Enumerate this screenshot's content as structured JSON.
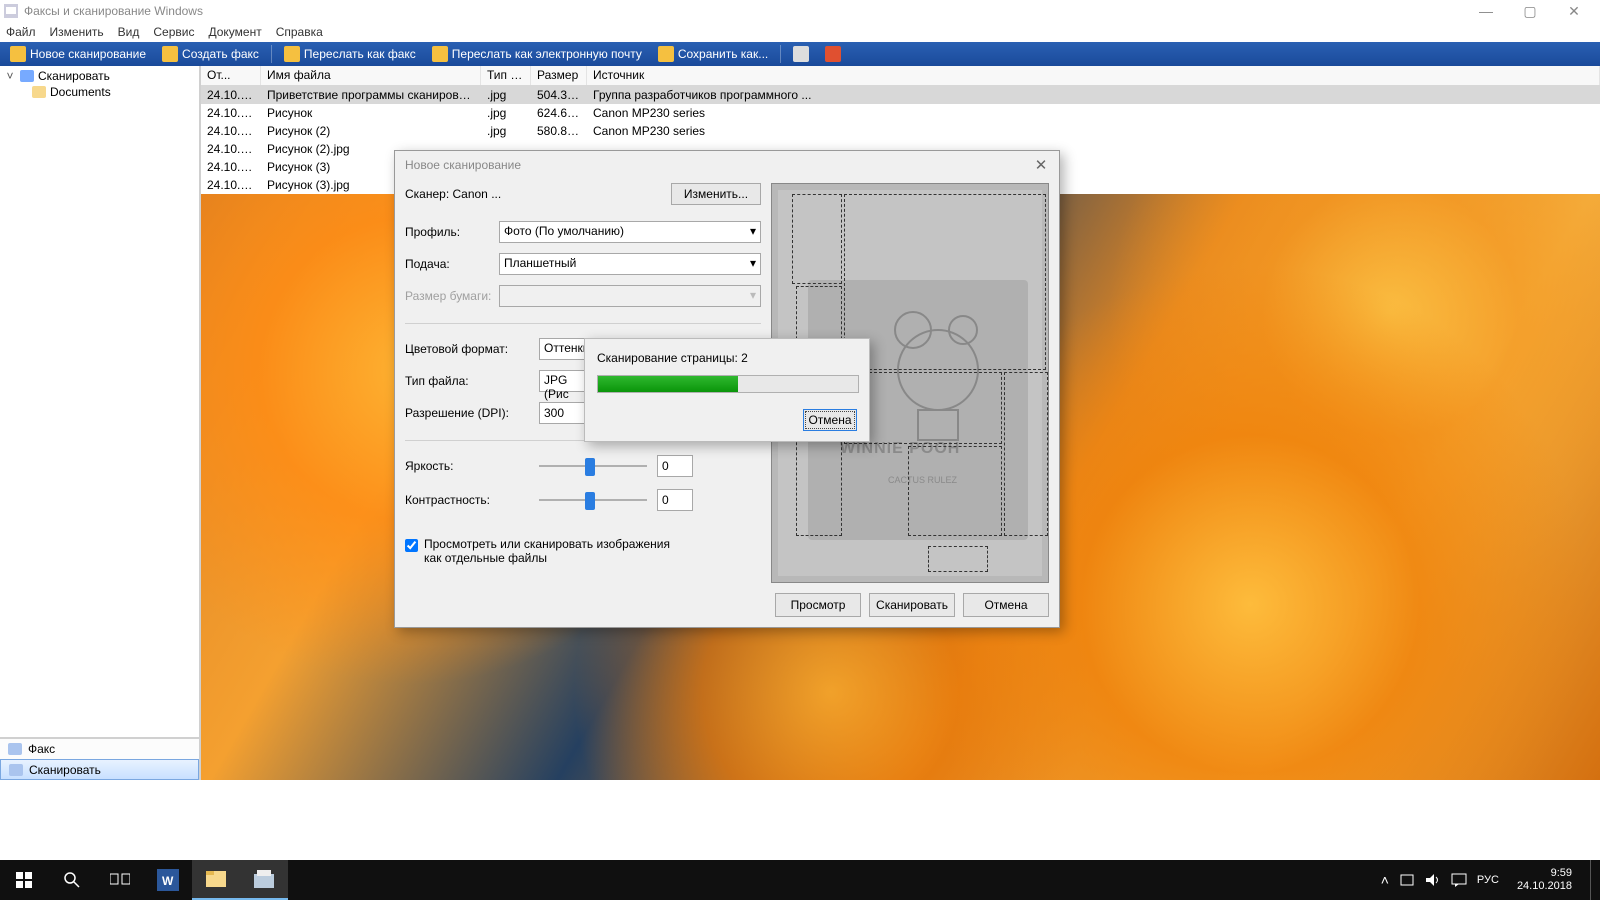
{
  "window": {
    "title": "Факсы и сканирование Windows",
    "controls": {
      "min": "—",
      "max": "▢",
      "close": "✕"
    }
  },
  "menu": [
    "Файл",
    "Изменить",
    "Вид",
    "Сервис",
    "Документ",
    "Справка"
  ],
  "toolbar": [
    "Новое сканирование",
    "Создать факс",
    "Переслать как факс",
    "Переслать как электронную почту",
    "Сохранить как..."
  ],
  "tree": {
    "root": "Сканировать",
    "child": "Documents"
  },
  "nav": {
    "fax": "Факс",
    "scan": "Сканировать"
  },
  "columns": {
    "date": "От...",
    "name": "Имя файла",
    "type": "Тип фа...",
    "size": "Размер",
    "src": "Источник"
  },
  "rows": [
    {
      "date": "24.10.201...",
      "name": "Приветствие программы сканирования",
      "type": ".jpg",
      "size": "504.3 КБ",
      "src": "Группа разработчиков программного ..."
    },
    {
      "date": "24.10.201...",
      "name": "Рисунок",
      "type": ".jpg",
      "size": "624.6 КБ",
      "src": "Canon MP230 series"
    },
    {
      "date": "24.10.201...",
      "name": "Рисунок (2)",
      "type": ".jpg",
      "size": "580.8 КБ",
      "src": "Canon MP230 series"
    },
    {
      "date": "24.10.201...",
      "name": "Рисунок (2).jpg",
      "type": "",
      "size": "",
      "src": ""
    },
    {
      "date": "24.10.201...",
      "name": "Рисунок (3)",
      "type": "",
      "size": "",
      "src": ""
    },
    {
      "date": "24.10.201...",
      "name": "Рисунок (3).jpg",
      "type": "",
      "size": "",
      "src": ""
    }
  ],
  "dialog": {
    "title": "Новое сканирование",
    "scanner_label": "Сканер: Canon ...",
    "change_btn": "Изменить...",
    "profile_label": "Профиль:",
    "profile_value": "Фото (По умолчанию)",
    "source_label": "Подача:",
    "source_value": "Планшетный",
    "paper_label": "Размер бумаги:",
    "color_label": "Цветовой формат:",
    "color_value": "Оттенки",
    "filetype_label": "Тип файла:",
    "filetype_value": "JPG (Рис",
    "dpi_label": "Разрешение (DPI):",
    "dpi_value": "300",
    "brightness_label": "Яркость:",
    "brightness_value": "0",
    "contrast_label": "Контрастность:",
    "contrast_value": "0",
    "checkbox_label": "Просмотреть или сканировать изображения как отдельные файлы",
    "preview_btn": "Просмотр",
    "scan_btn": "Сканировать",
    "cancel_btn": "Отмена",
    "art_text1": "WINNIE POOH",
    "art_text2": "CACTUS RULEZ"
  },
  "progress": {
    "label": "Сканирование страницы: 2",
    "percent": 54,
    "cancel": "Отмена"
  },
  "taskbar": {
    "lang": "РУС",
    "time": "9:59",
    "date": "24.10.2018"
  }
}
